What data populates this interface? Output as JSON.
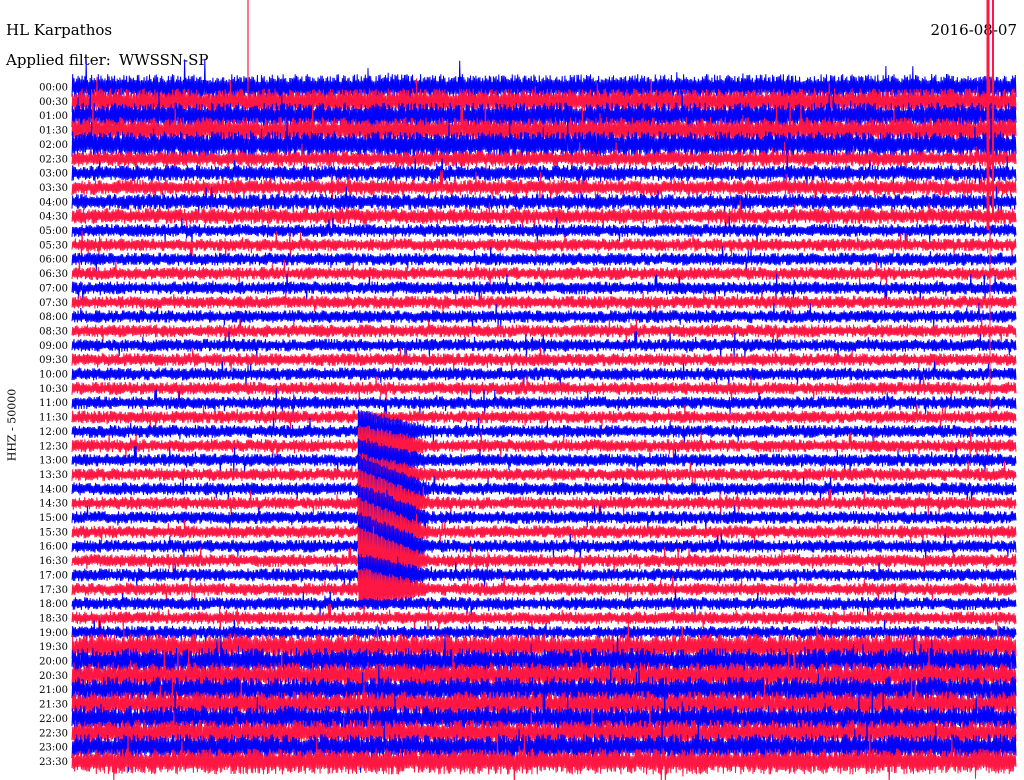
{
  "header": {
    "station": "HL Karpathos",
    "filter_label": "Applied filter:",
    "filter_value": "WWSSN-SP",
    "date": "2016-08-07"
  },
  "chart_data": {
    "type": "line",
    "title": "HL Karpathos",
    "subtitle": "Applied filter: WWSSN-SP",
    "date": "2016-08-07",
    "ylabel": "HHZ - 50000",
    "xlabel": "",
    "rows": [
      "00:00",
      "00:30",
      "01:00",
      "01:30",
      "02:00",
      "02:30",
      "03:00",
      "03:30",
      "04:00",
      "04:30",
      "05:00",
      "05:30",
      "06:00",
      "06:30",
      "07:00",
      "07:30",
      "08:00",
      "08:30",
      "09:00",
      "09:30",
      "10:00",
      "10:30",
      "11:00",
      "11:30",
      "12:00",
      "12:30",
      "13:00",
      "13:30",
      "14:00",
      "14:30",
      "15:00",
      "15:30",
      "16:00",
      "16:30",
      "17:00",
      "17:30",
      "18:00",
      "18:30",
      "19:00",
      "19:30",
      "20:00",
      "20:30",
      "21:00",
      "21:30",
      "22:00",
      "22:30",
      "23:00",
      "23:30"
    ],
    "colors": {
      "even_rows": "#0000ff",
      "odd_rows": "#ff1744"
    },
    "row_duration_minutes": 30,
    "grid": false,
    "legend": "none"
  }
}
